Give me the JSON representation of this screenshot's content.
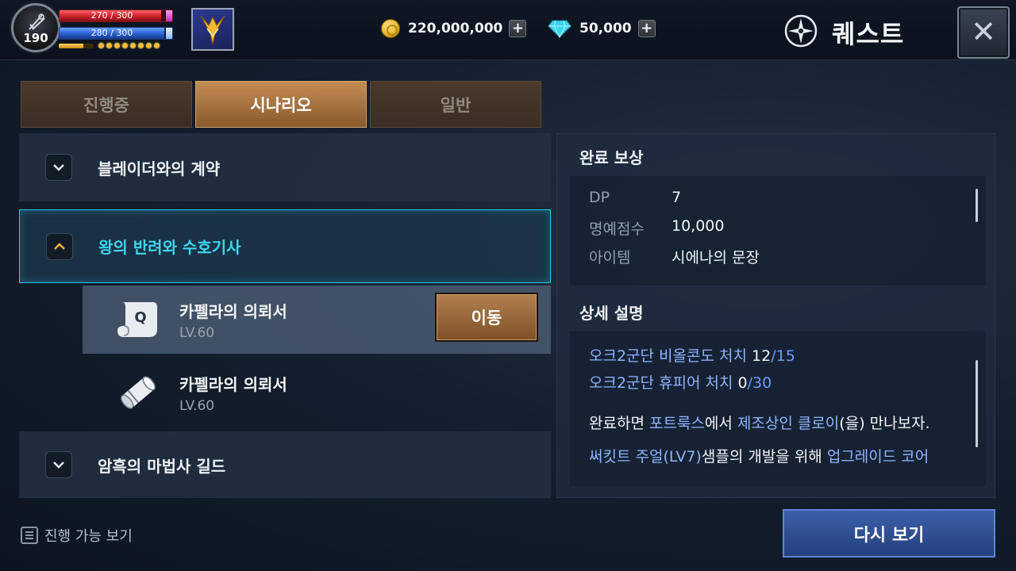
{
  "player": {
    "level": "190",
    "hp_text": "270 / 300",
    "hp_fraction": 0.9,
    "mp_text": "280 / 300",
    "mp_fraction": 0.93,
    "exp_fraction": 0.7,
    "charge_dots": 8
  },
  "currency": {
    "gold": "220,000,000",
    "gems": "50,000",
    "add_symbol": "+"
  },
  "header": {
    "title": "퀘스트",
    "close_symbol": "✕"
  },
  "tabs": [
    {
      "label": "진행중",
      "active": false
    },
    {
      "label": "시나리오",
      "active": true
    },
    {
      "label": "일반",
      "active": false
    }
  ],
  "quest_groups": [
    {
      "label": "블레이더와의 계약",
      "expanded": false
    },
    {
      "label": "왕의 반려와 수호기사",
      "expanded": true
    },
    {
      "label": "암흑의 마법사 길드",
      "expanded": false
    }
  ],
  "quests": [
    {
      "name": "카펠라의 의뢰서",
      "level": "LV.60",
      "icon": "quest-scroll-icon",
      "selected": true
    },
    {
      "name": "카펠라의 의뢰서",
      "level": "LV.60",
      "icon": "rolled-scroll-icon",
      "selected": false
    }
  ],
  "move_button": "이동",
  "filter_label": "진행 가능 보기",
  "reward": {
    "title": "완료 보상",
    "rows": [
      {
        "key": "DP",
        "value": "7"
      },
      {
        "key": "명예점수",
        "value": "10,000"
      },
      {
        "key": "아이템",
        "value": "시에나의 문장"
      }
    ]
  },
  "detail": {
    "title": "상세 설명",
    "objectives": [
      {
        "target": "오크2군단 비올콘도 처치",
        "current": "12",
        "total": "/15"
      },
      {
        "target": "오크2군단 휴피어 처치",
        "current": "0",
        "total": "/30"
      }
    ],
    "line1": {
      "p1": "완료하면 ",
      "h1": "포트룩스",
      "p2": "에서 ",
      "h2": "제조상인 클로이",
      "p3": "(을) 만나보자."
    },
    "line2": {
      "h1": "써킷트 주얼(LV7)",
      "p1": "샘플의 개발을 위해 ",
      "h2": "업그레이드 코어"
    }
  },
  "replay_button": "다시 보기",
  "colors": {
    "accent_cyan": "#21c9e6",
    "tab_active": "#c38c52",
    "highlight_blue": "#8fb4ff",
    "replay_blue": "#3b5fa8"
  }
}
